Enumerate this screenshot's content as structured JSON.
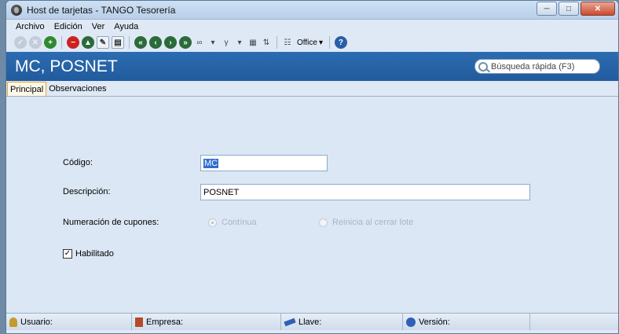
{
  "window": {
    "title": "Host de tarjetas - TANGO Tesorería"
  },
  "menu": {
    "items": [
      "Archivo",
      "Edición",
      "Ver",
      "Ayuda"
    ]
  },
  "toolbar": {
    "office_label": "Office"
  },
  "header": {
    "title": "MC, POSNET"
  },
  "search": {
    "placeholder": "Búsqueda rápida (F3)"
  },
  "tabs": [
    "Principal",
    "Observaciones"
  ],
  "form": {
    "codigo_label": "Código:",
    "codigo_value": "MC",
    "descripcion_label": "Descripción:",
    "descripcion_value": "POSNET",
    "numeracion_label": "Numeración de cupones:",
    "numeracion_options": [
      "Contínua",
      "Reinicia al cerrar lote"
    ],
    "numeracion_selected": "Contínua",
    "habilitado_label": "Habilitado",
    "habilitado_checked": true
  },
  "status": {
    "usuario_label": "Usuario:",
    "empresa_label": "Empresa:",
    "llave_label": "Llave:",
    "version_label": "Versión:"
  },
  "colors": {
    "header_bg": "#2c6cb2",
    "tab_active_border": "#e7a33a",
    "selection": "#2f6fd0"
  }
}
